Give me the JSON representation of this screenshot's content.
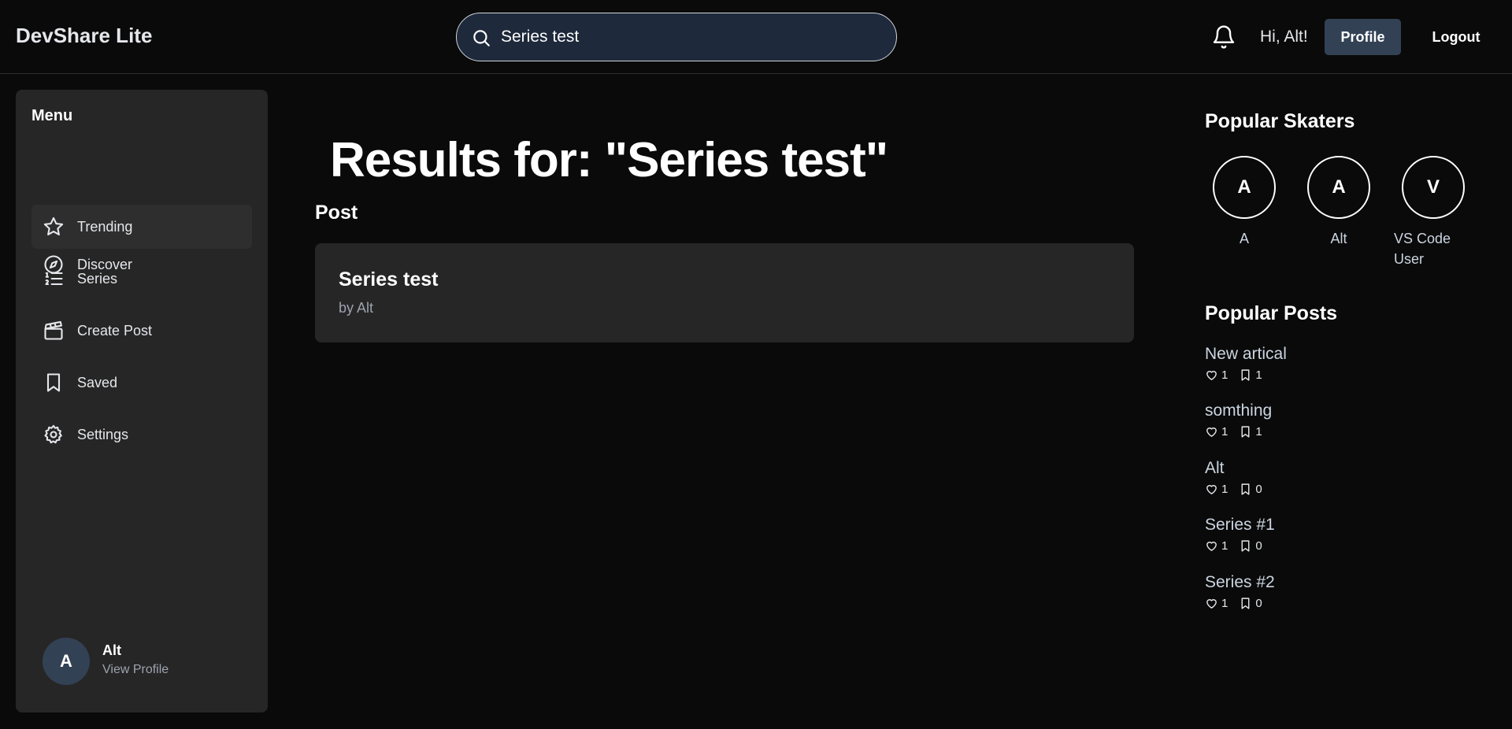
{
  "header": {
    "brand": "DevShare Lite",
    "search_value": "Series test",
    "greeting": "Hi, Alt!",
    "profile_label": "Profile",
    "logout_label": "Logout"
  },
  "sidebar": {
    "title": "Menu",
    "items": [
      {
        "label": "Discover",
        "icon": "compass-icon"
      },
      {
        "label": "Trending",
        "icon": "star-icon"
      },
      {
        "label": "Series",
        "icon": "list-icon"
      },
      {
        "label": "Create Post",
        "icon": "clapperboard-icon"
      },
      {
        "label": "Saved",
        "icon": "bookmark-icon"
      },
      {
        "label": "Settings",
        "icon": "gear-icon"
      }
    ],
    "user": {
      "initial": "A",
      "name": "Alt",
      "link": "View Profile"
    }
  },
  "main": {
    "title": "Results for: \"Series test\"",
    "section": "Post",
    "results": [
      {
        "title": "Series test",
        "author": "by Alt"
      }
    ]
  },
  "right": {
    "skaters_title": "Popular Skaters",
    "skaters": [
      {
        "initial": "A",
        "name": "A"
      },
      {
        "initial": "A",
        "name": "Alt"
      },
      {
        "initial": "V",
        "name": "VS Code User"
      }
    ],
    "posts_title": "Popular Posts",
    "posts": [
      {
        "title": "New artical",
        "likes": "1",
        "saves": "1"
      },
      {
        "title": "somthing",
        "likes": "1",
        "saves": "1"
      },
      {
        "title": "Alt",
        "likes": "1",
        "saves": "0"
      },
      {
        "title": "Series #1",
        "likes": "1",
        "saves": "0"
      },
      {
        "title": "Series #2",
        "likes": "1",
        "saves": "0"
      }
    ]
  },
  "colors": {
    "background": "#0a0a0a",
    "panel": "#262626",
    "accent": "#334155",
    "muted_text": "#9ca3af"
  }
}
